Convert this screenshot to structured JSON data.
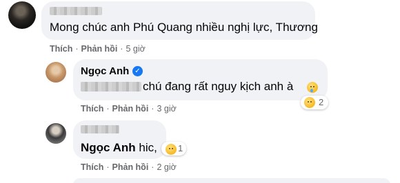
{
  "comments": [
    {
      "text": "Mong chúc anh Phú Quang nhiều nghị lực, Thương",
      "like_label": "Thích",
      "reply_label": "Phản hồi",
      "time": "5 giờ"
    },
    {
      "author": "Ngọc Anh",
      "verified": true,
      "text": "chú đang rất nguy kịch anh à",
      "reaction_count": "2",
      "like_label": "Thích",
      "reply_label": "Phản hồi",
      "time": "3 giờ"
    },
    {
      "mention": "Ngọc Anh",
      "text": "hic,",
      "reaction_count": "1",
      "like_label": "Thích",
      "reply_label": "Phản hồi",
      "time": "2 giờ"
    }
  ],
  "separator": "·",
  "icons": [
    "verified-badge-icon",
    "crying-face-emoji",
    "sad-reaction-icon"
  ],
  "colors": {
    "bubble": "#f0f2f5",
    "meta": "#65676b",
    "verified": "#1877f2",
    "emoji": "#f7b928"
  }
}
